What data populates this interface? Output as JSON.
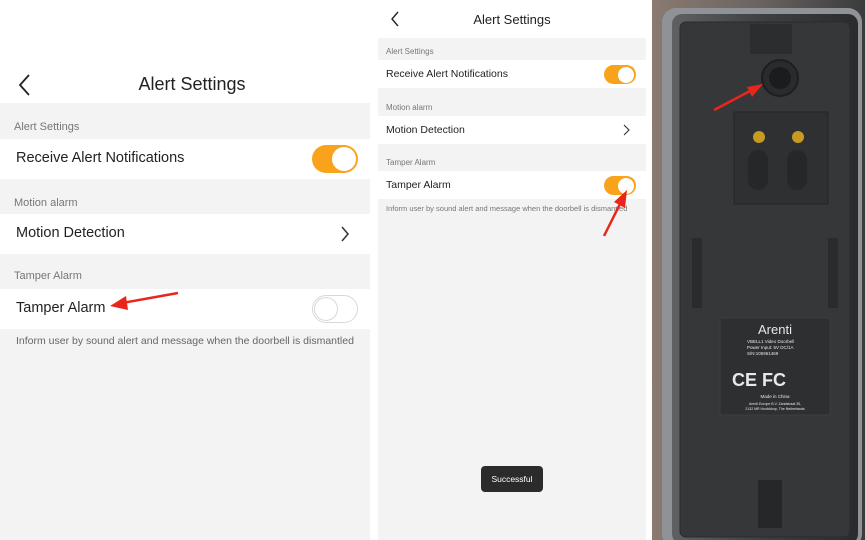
{
  "panel_a": {
    "title": "Alert Settings",
    "sections": {
      "alert_settings": "Alert Settings",
      "motion_alarm": "Motion alarm",
      "tamper_alarm": "Tamper Alarm"
    },
    "rows": {
      "receive_alert": "Receive Alert Notifications",
      "motion_detection": "Motion Detection",
      "tamper_alarm": "Tamper Alarm"
    },
    "toggles": {
      "receive_alert": "on",
      "tamper_alarm": "off"
    },
    "description": "Inform user by sound alert and message when the doorbell is dismantled"
  },
  "panel_b": {
    "title": "Alert Settings",
    "sections": {
      "alert_settings": "Alert Settings",
      "motion_alarm": "Motion alarm",
      "tamper_alarm": "Tamper Alarm"
    },
    "rows": {
      "receive_alert": "Receive Alert Notifications",
      "motion_detection": "Motion Detection",
      "tamper_alarm": "Tamper Alarm"
    },
    "toggles": {
      "receive_alert": "on",
      "tamper_alarm": "on"
    },
    "description": "Inform user by sound alert and message when the doorbell is dismantled",
    "toast": "Successful"
  },
  "photo": {
    "brand": "Arenti",
    "label_lines": [
      "VBELL1 Video Doorbell",
      "Power Input: 5V DC/1A",
      "S/N:105961469"
    ],
    "made_in": "Made in China",
    "address_lines": [
      "Arenti Europe B.V. Zandstraat 35,",
      "2132 MR Hoofddorp, The Netherlands"
    ],
    "cert_marks": "CE FC"
  },
  "colors": {
    "accent": "#f8a31b",
    "arrow": "#e8261c",
    "page_bg": "#f3f3f3"
  },
  "icons": [
    "back-chevron-icon",
    "chevron-right-icon",
    "red-arrow-icon"
  ]
}
